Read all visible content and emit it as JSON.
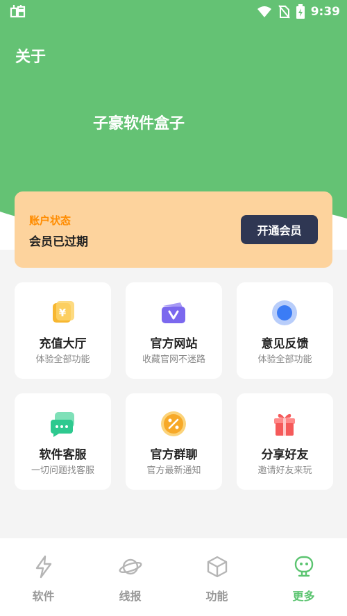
{
  "status_bar": {
    "time": "9:39",
    "left_icon": "bug-icon",
    "icons": [
      "wifi-icon",
      "no-sim-icon",
      "battery-charging-icon"
    ]
  },
  "header": {
    "page_title": "关于",
    "app_name": "子豪软件盒子"
  },
  "account": {
    "label": "账户状态",
    "status": "会员已过期",
    "vip_button": "开通会员"
  },
  "grid": [
    {
      "title": "充值大厅",
      "subtitle": "体验全部功能",
      "icon": "yen-coin-icon"
    },
    {
      "title": "官方网站",
      "subtitle": "收藏官网不迷路",
      "icon": "v-card-icon"
    },
    {
      "title": "意见反馈",
      "subtitle": "体验全部功能",
      "icon": "blue-circle-icon"
    },
    {
      "title": "软件客服",
      "subtitle": "一切问题找客服",
      "icon": "chat-bubble-icon"
    },
    {
      "title": "官方群聊",
      "subtitle": "官方最新通知",
      "icon": "percent-coin-icon"
    },
    {
      "title": "分享好友",
      "subtitle": "邀请好友来玩",
      "icon": "gift-icon"
    }
  ],
  "bottom_nav": {
    "items": [
      {
        "label": "软件",
        "icon": "lightning-icon",
        "active": false
      },
      {
        "label": "线报",
        "icon": "planet-icon",
        "active": false
      },
      {
        "label": "功能",
        "icon": "cube-icon",
        "active": false
      },
      {
        "label": "更多",
        "icon": "robot-icon",
        "active": true
      }
    ]
  },
  "colors": {
    "header_green": "#64c274",
    "card_orange": "#fdd39d",
    "account_label": "#ff8c00",
    "vip_button": "#2f3753",
    "nav_active": "#5bc470",
    "nav_inactive": "#999999"
  }
}
